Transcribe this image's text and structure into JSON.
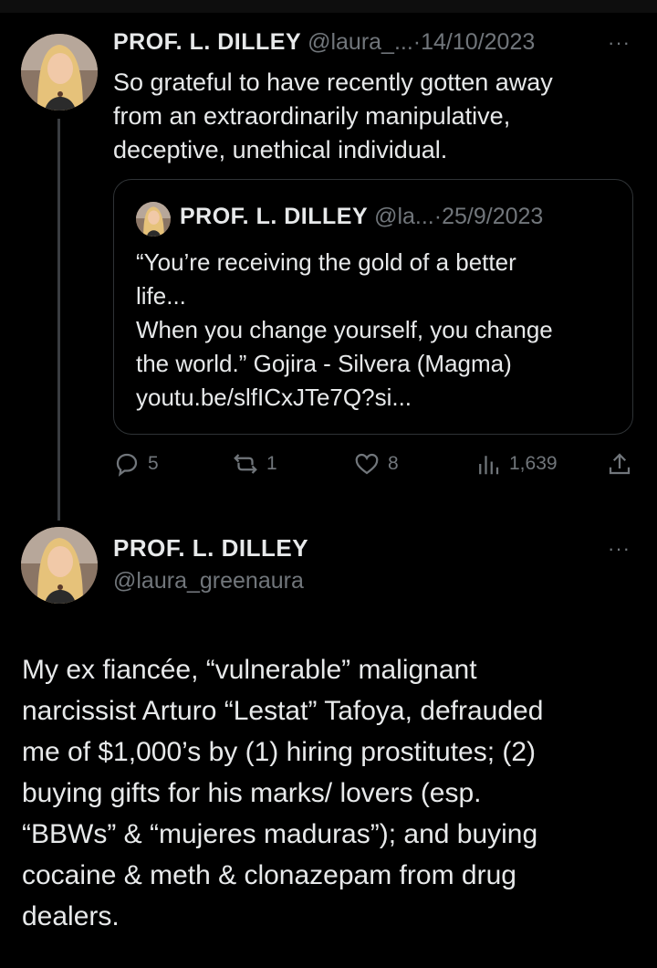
{
  "tweet1": {
    "display_name": "PROF. L. DILLEY",
    "handle": "@laura_...",
    "separator": "·",
    "date": "14/10/2023",
    "more": "···",
    "text_lines": [
      "So grateful to have recently gotten away",
      "from an extraordinarily manipulative,",
      "deceptive, unethical individual."
    ],
    "quote": {
      "display_name": "PROF. L. DILLEY",
      "handle": "@la...",
      "separator": "·",
      "date": "25/9/2023",
      "text_lines": [
        "“You’re receiving the gold of a better",
        "life...",
        "When you change yourself, you change",
        "the world.” Gojira - Silvera (Magma)",
        "youtu.be/slfICxJTe7Q?si..."
      ]
    },
    "actions": {
      "replies": "5",
      "reposts": "1",
      "likes": "8",
      "views": "1,639"
    }
  },
  "tweet2": {
    "display_name": "PROF. L. DILLEY",
    "handle": "@laura_greenaura",
    "more": "···",
    "text_lines": [
      "My ex fiancée, “vulnerable” malignant",
      "narcissist Arturo “Lestat” Tafoya, defrauded",
      "me of $1,000’s by (1) hiring prostitutes; (2)",
      "buying gifts for his marks/ lovers (esp.",
      "“BBWs” & “mujeres maduras”); and buying",
      "cocaine & meth & clonazepam from drug",
      "dealers."
    ]
  },
  "icons": [
    "reply-icon",
    "repost-icon",
    "like-icon",
    "views-icon",
    "share-icon",
    "more-icon"
  ],
  "colors": {
    "background": "#000000",
    "text": "#e7e9ea",
    "muted": "#71767b",
    "border": "#2f3336"
  }
}
